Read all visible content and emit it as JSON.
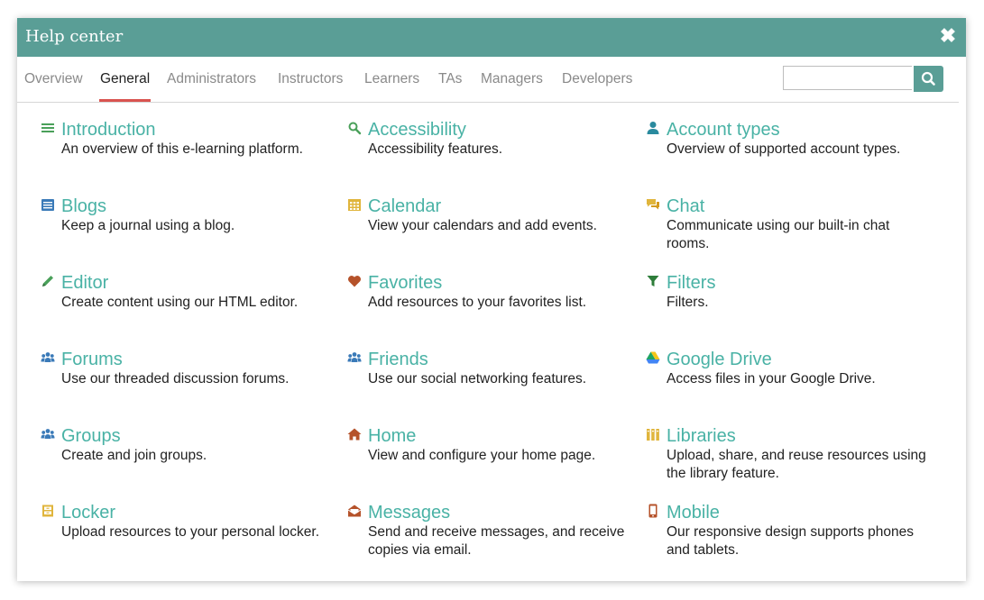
{
  "dialog": {
    "title": "Help center",
    "close_icon": "close-icon"
  },
  "tabs": [
    {
      "label": "Overview",
      "active": false
    },
    {
      "label": "General",
      "active": true
    },
    {
      "label": "Administrators",
      "active": false
    },
    {
      "label": "Instructors",
      "active": false
    },
    {
      "label": "Learners",
      "active": false
    },
    {
      "label": "TAs",
      "active": false
    },
    {
      "label": "Managers",
      "active": false
    },
    {
      "label": "Developers",
      "active": false
    }
  ],
  "search": {
    "value": "",
    "placeholder": "",
    "button_icon": "search-icon"
  },
  "colors": {
    "header": "#5a9e96",
    "link": "#49b2a5",
    "active_tab_underline": "#d9534f"
  },
  "topics": [
    {
      "name": "Introduction",
      "desc": "An overview of this e-learning platform.",
      "icon": "list-icon"
    },
    {
      "name": "Accessibility",
      "desc": "Accessibility features.",
      "icon": "magnifier-icon"
    },
    {
      "name": "Account types",
      "desc": "Overview of supported account types.",
      "icon": "user-icon"
    },
    {
      "name": "Blogs",
      "desc": "Keep a journal using a blog.",
      "icon": "blog-icon"
    },
    {
      "name": "Calendar",
      "desc": "View your calendars and add events.",
      "icon": "calendar-icon"
    },
    {
      "name": "Chat",
      "desc": "Communicate using our built-in chat rooms.",
      "icon": "chat-icon"
    },
    {
      "name": "Editor",
      "desc": "Create content using our HTML editor.",
      "icon": "pencil-icon"
    },
    {
      "name": "Favorites",
      "desc": "Add resources to your favorites list.",
      "icon": "heart-icon"
    },
    {
      "name": "Filters",
      "desc": "Filters.",
      "icon": "filter-icon"
    },
    {
      "name": "Forums",
      "desc": "Use our threaded discussion forums.",
      "icon": "people-icon"
    },
    {
      "name": "Friends",
      "desc": "Use our social networking features.",
      "icon": "people-icon"
    },
    {
      "name": "Google Drive",
      "desc": "Access files in your Google Drive.",
      "icon": "google-drive-icon"
    },
    {
      "name": "Groups",
      "desc": "Create and join groups.",
      "icon": "people-icon"
    },
    {
      "name": "Home",
      "desc": "View and configure your home page.",
      "icon": "home-icon"
    },
    {
      "name": "Libraries",
      "desc": "Upload, share, and reuse resources using the library feature.",
      "icon": "books-icon"
    },
    {
      "name": "Locker",
      "desc": "Upload resources to your personal locker.",
      "icon": "locker-icon"
    },
    {
      "name": "Messages",
      "desc": "Send and receive messages, and receive copies via email.",
      "icon": "envelope-icon"
    },
    {
      "name": "Mobile",
      "desc": "Our responsive design supports phones and tablets.",
      "icon": "mobile-icon"
    }
  ]
}
